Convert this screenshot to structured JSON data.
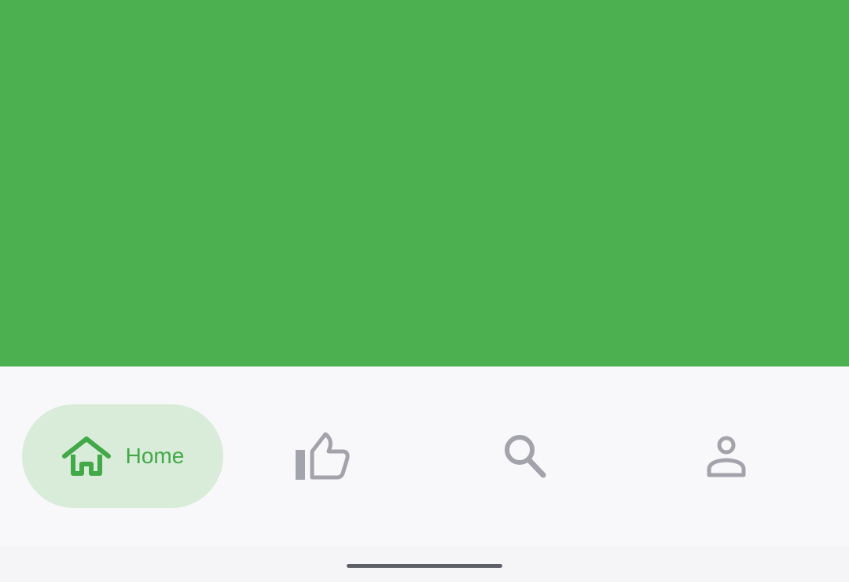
{
  "colors": {
    "hero_background": "#4caf50",
    "active_tint": "#43a848",
    "active_pill": "#d8ecd9",
    "inactive_icon": "#a3a3ab"
  },
  "bottom_nav": {
    "items": [
      {
        "id": "home",
        "label": "Home",
        "icon": "home-icon",
        "active": true
      },
      {
        "id": "like",
        "icon": "thumbs-up-icon",
        "active": false
      },
      {
        "id": "search",
        "icon": "search-icon",
        "active": false
      },
      {
        "id": "profile",
        "icon": "person-icon",
        "active": false
      }
    ]
  }
}
